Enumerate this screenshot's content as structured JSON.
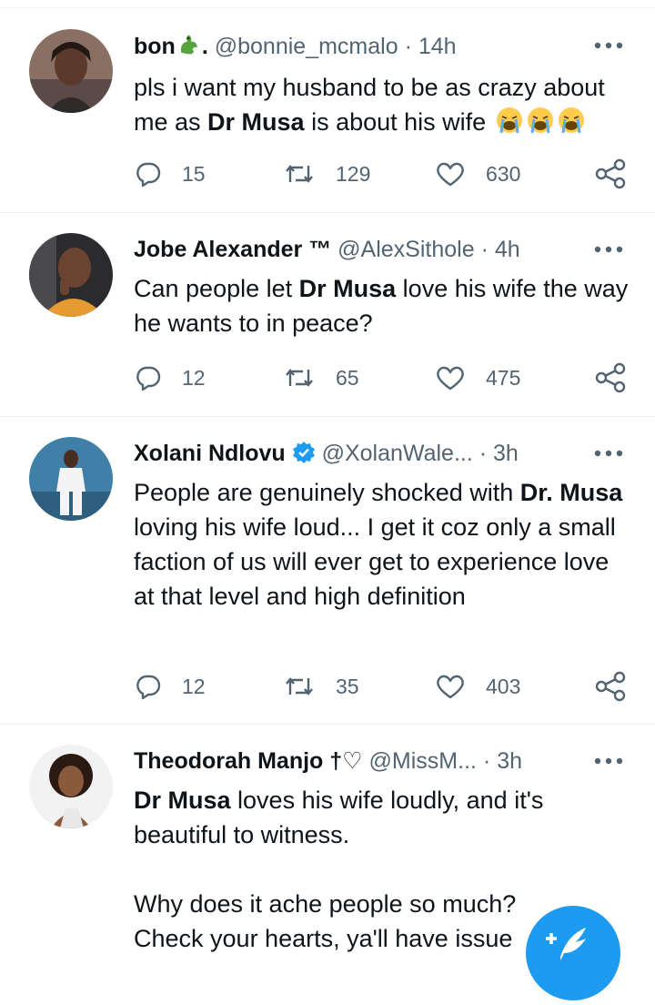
{
  "tweets": [
    {
      "name": "bon",
      "name_suffix": ".",
      "handle": "@bonnie_mcmalo",
      "sep": "·",
      "time": "14h",
      "text_parts": [
        "pls i want my husband to be as crazy about me as ",
        "Dr Musa",
        " is about his wife"
      ],
      "emojis": [
        "loudly-crying-face",
        "loudly-crying-face",
        "loudly-crying-face"
      ],
      "replies": "15",
      "retweets": "129",
      "likes": "630"
    },
    {
      "name": "Jobe Alexander ™",
      "handle": "@AlexSithole",
      "sep": "·",
      "time": "4h",
      "text_parts": [
        "Can people let ",
        "Dr Musa",
        " love his wife the way he wants to in peace?"
      ],
      "replies": "12",
      "retweets": "65",
      "likes": "475"
    },
    {
      "name": "Xolani Ndlovu",
      "verified": true,
      "handle": "@XolanWale...",
      "sep": "·",
      "time": "3h",
      "text_parts": [
        "People are genuinely shocked with ",
        "Dr. Musa",
        " loving his wife loud... I get it coz only a small faction of us will ever get to experience love at that level and high definition"
      ],
      "replies": "12",
      "retweets": "35",
      "likes": "403"
    },
    {
      "name": "Theodorah Manjo †♡",
      "handle": "@MissM...",
      "sep": "·",
      "time": "3h",
      "text_parts": [
        "Dr Musa",
        " loves his wife loudly, and it's beautiful to witness."
      ],
      "text_line2": "Why does it ache people so much?",
      "text_line3": "Check your hearts, ya'll have issue"
    }
  ],
  "icons": [
    "reply-icon",
    "retweet-icon",
    "like-icon",
    "share-icon",
    "more-icon",
    "verified-icon",
    "compose-icon",
    "dragon-emoji"
  ],
  "colors": {
    "accent": "#1d9bf0",
    "secondary_text": "#536471",
    "divider": "#e6ecf0"
  }
}
